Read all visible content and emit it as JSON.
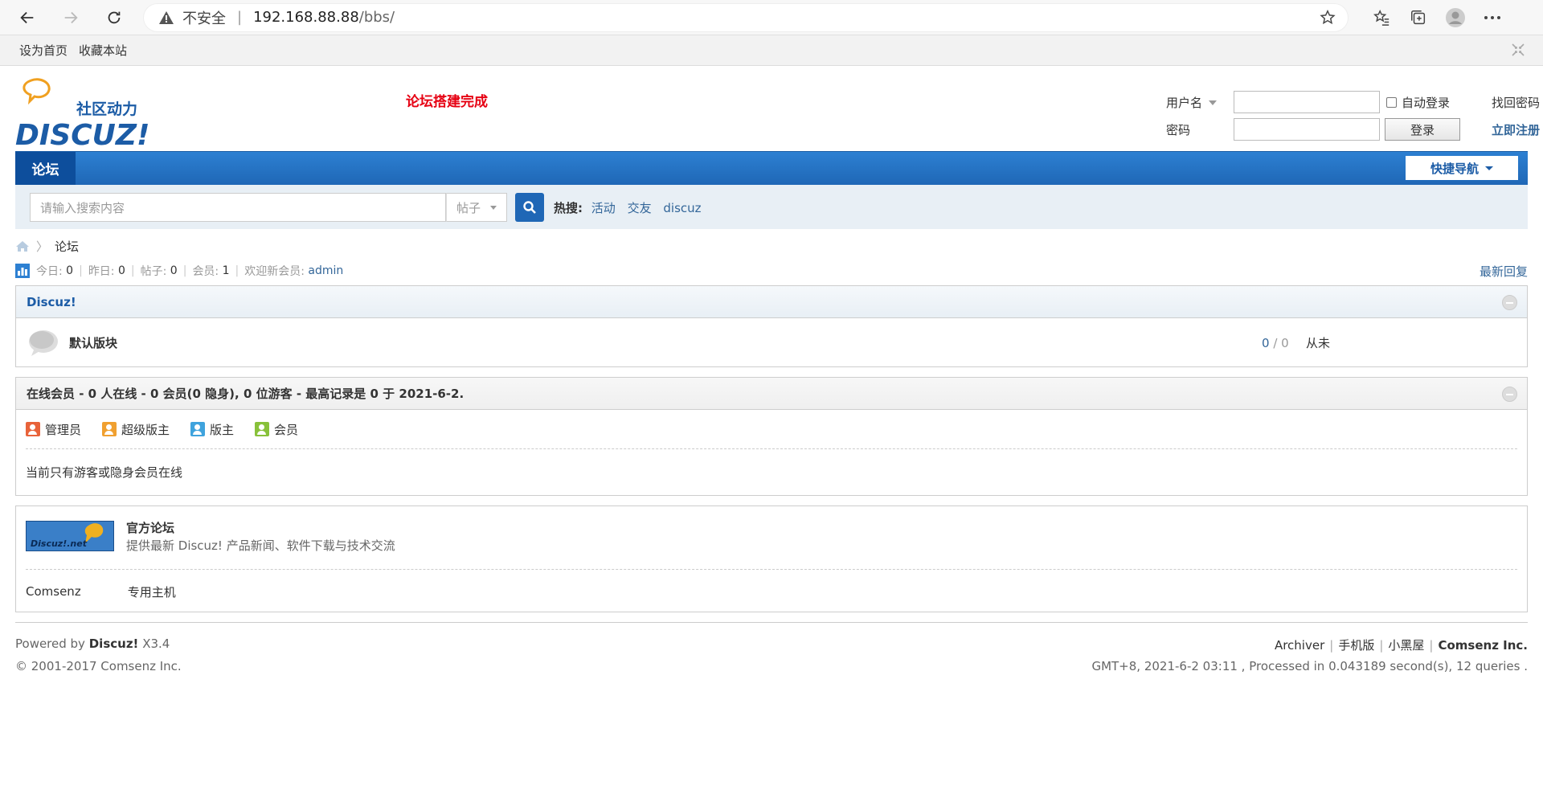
{
  "browser": {
    "security_label": "不安全",
    "url_host": "192.168.88.88",
    "url_path": "/bbs/"
  },
  "favorites": {
    "set_home": "设为首页",
    "bookmark": "收藏本站"
  },
  "header": {
    "logo_text": "Discuz!",
    "logo_tagline": "社区动力",
    "notice": "论坛搭建完成"
  },
  "login": {
    "username_label": "用户名",
    "password_label": "密码",
    "auto_login": "自动登录",
    "login_button": "登录",
    "forgot_password": "找回密码",
    "register": "立即注册"
  },
  "nav": {
    "active_tab": "论坛",
    "quick_nav": "快捷导航"
  },
  "search": {
    "placeholder": "请输入搜索内容",
    "type": "帖子",
    "hot_label": "热搜:",
    "hot_terms": [
      "活动",
      "交友",
      "discuz"
    ]
  },
  "breadcrumb": {
    "current": "论坛"
  },
  "stats": {
    "today_label": "今日:",
    "today": "0",
    "yesterday_label": "昨日:",
    "yesterday": "0",
    "posts_label": "帖子:",
    "posts": "0",
    "members_label": "会员:",
    "members": "1",
    "welcome_label": "欢迎新会员:",
    "newest_member": "admin",
    "latest_reply": "最新回复"
  },
  "category": {
    "name": "Discuz!",
    "forum_name": "默认版块",
    "threads": "0",
    "posts": "0",
    "last_post": "从未"
  },
  "online": {
    "title": "在线会员 - 0 人在线 - 0 会员(0 隐身), 0 位游客 - 最高记录是 0 于 2021-6-2.",
    "legend": [
      {
        "label": "管理员",
        "color": "#e8633a"
      },
      {
        "label": "超级版主",
        "color": "#f0a030"
      },
      {
        "label": "版主",
        "color": "#3fa3dd"
      },
      {
        "label": "会员",
        "color": "#88c13a"
      }
    ],
    "message": "当前只有游客或隐身会员在线"
  },
  "links": {
    "official_logo_text": "Discuz!.net",
    "official_title": "官方论坛",
    "official_desc": "提供最新 Discuz! 产品新闻、软件下载与技术交流",
    "text_links": [
      "Comsenz",
      "专用主机"
    ]
  },
  "footer": {
    "powered_prefix": "Powered by",
    "powered_brand": "Discuz!",
    "version": "X3.4",
    "copyright": "© 2001-2017 Comsenz Inc.",
    "links": [
      "Archiver",
      "手机版",
      "小黑屋"
    ],
    "company": "Comsenz Inc.",
    "processed": "GMT+8, 2021-6-2 03:11 , Processed in 0.043189 second(s), 12 queries ."
  }
}
